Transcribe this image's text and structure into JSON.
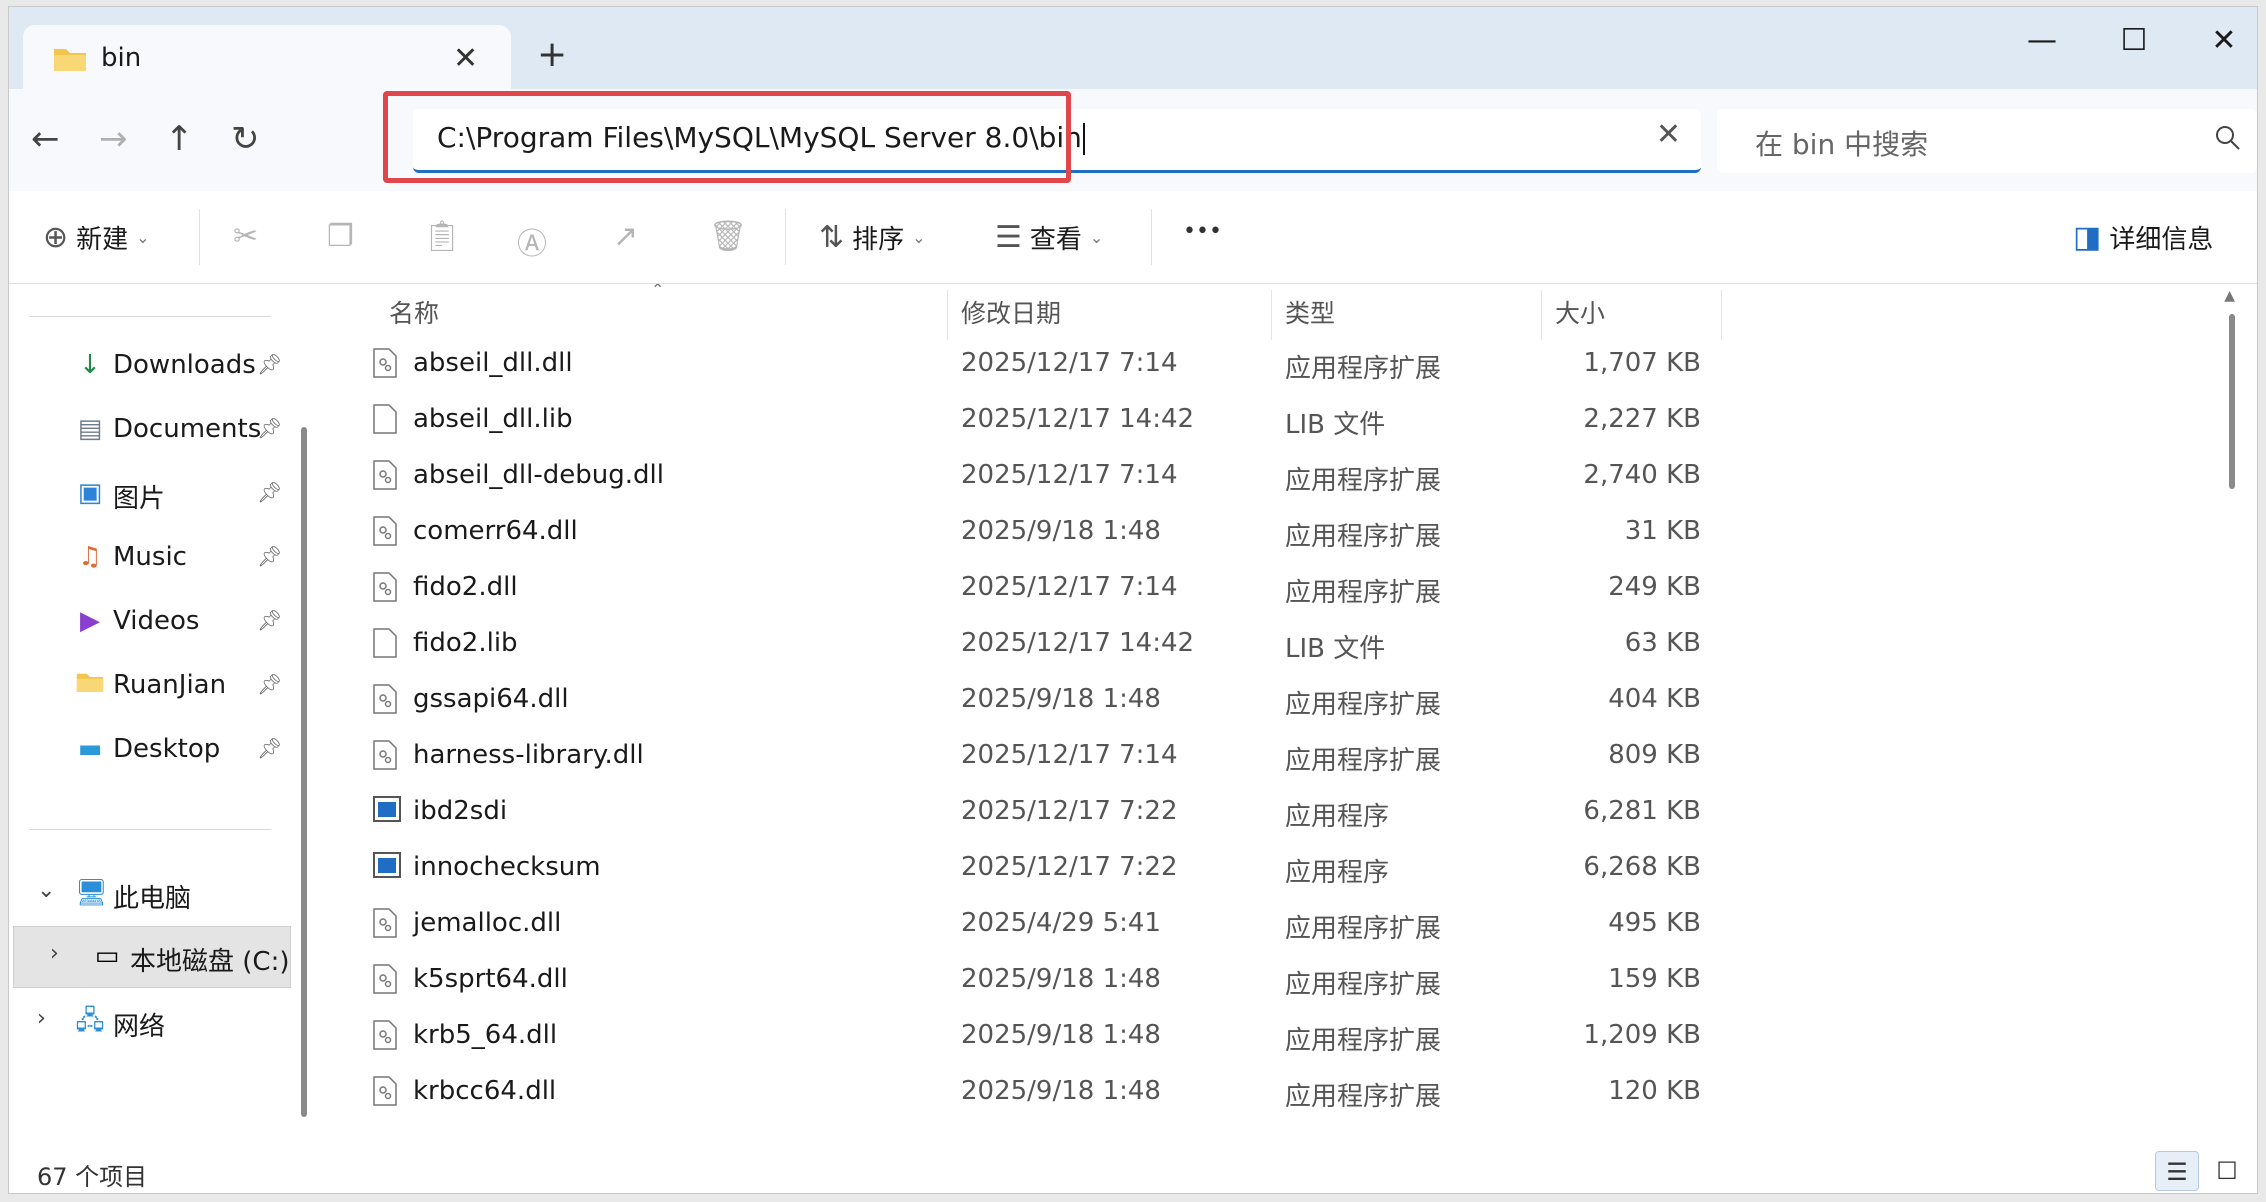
{
  "window": {
    "tab_title": "bin",
    "new_tab_label": "+"
  },
  "nav": {
    "address": "C:\\Program Files\\MySQL\\MySQL Server 8.0\\bin",
    "search_placeholder": "在 bin 中搜索"
  },
  "toolbar": {
    "new_label": "新建",
    "sort_label": "排序",
    "view_label": "查看",
    "more_label": "•••",
    "details_label": "详细信息"
  },
  "sidebar": {
    "quick_access": [
      {
        "label": "Downloads",
        "icon": "download-icon"
      },
      {
        "label": "Documents",
        "icon": "document-icon"
      },
      {
        "label": "图片",
        "icon": "pictures-icon"
      },
      {
        "label": "Music",
        "icon": "music-icon"
      },
      {
        "label": "Videos",
        "icon": "videos-icon"
      },
      {
        "label": "RuanJian",
        "icon": "folder-icon"
      },
      {
        "label": "Desktop",
        "icon": "desktop-icon"
      }
    ],
    "this_pc": "此电脑",
    "local_disk": "本地磁盘 (C:)",
    "network": "网络"
  },
  "columns": {
    "name": "名称",
    "date": "修改日期",
    "type": "类型",
    "size": "大小"
  },
  "files": [
    {
      "name": "abseil_dll.dll",
      "date": "2025/12/17 7:14",
      "type": "应用程序扩展",
      "size": "1,707 KB",
      "kind": "dll"
    },
    {
      "name": "abseil_dll.lib",
      "date": "2025/12/17 14:42",
      "type": "LIB 文件",
      "size": "2,227 KB",
      "kind": "file"
    },
    {
      "name": "abseil_dll-debug.dll",
      "date": "2025/12/17 7:14",
      "type": "应用程序扩展",
      "size": "2,740 KB",
      "kind": "dll"
    },
    {
      "name": "comerr64.dll",
      "date": "2025/9/18 1:48",
      "type": "应用程序扩展",
      "size": "31 KB",
      "kind": "dll"
    },
    {
      "name": "fido2.dll",
      "date": "2025/12/17 7:14",
      "type": "应用程序扩展",
      "size": "249 KB",
      "kind": "dll"
    },
    {
      "name": "fido2.lib",
      "date": "2025/12/17 14:42",
      "type": "LIB 文件",
      "size": "63 KB",
      "kind": "file"
    },
    {
      "name": "gssapi64.dll",
      "date": "2025/9/18 1:48",
      "type": "应用程序扩展",
      "size": "404 KB",
      "kind": "dll"
    },
    {
      "name": "harness-library.dll",
      "date": "2025/12/17 7:14",
      "type": "应用程序扩展",
      "size": "809 KB",
      "kind": "dll"
    },
    {
      "name": "ibd2sdi",
      "date": "2025/12/17 7:22",
      "type": "应用程序",
      "size": "6,281 KB",
      "kind": "exe"
    },
    {
      "name": "innochecksum",
      "date": "2025/12/17 7:22",
      "type": "应用程序",
      "size": "6,268 KB",
      "kind": "exe"
    },
    {
      "name": "jemalloc.dll",
      "date": "2025/4/29 5:41",
      "type": "应用程序扩展",
      "size": "495 KB",
      "kind": "dll"
    },
    {
      "name": "k5sprt64.dll",
      "date": "2025/9/18 1:48",
      "type": "应用程序扩展",
      "size": "159 KB",
      "kind": "dll"
    },
    {
      "name": "krb5_64.dll",
      "date": "2025/9/18 1:48",
      "type": "应用程序扩展",
      "size": "1,209 KB",
      "kind": "dll"
    },
    {
      "name": "krbcc64.dll",
      "date": "2025/9/18 1:48",
      "type": "应用程序扩展",
      "size": "120 KB",
      "kind": "dll"
    }
  ],
  "status": {
    "item_count": "67 个项目"
  }
}
